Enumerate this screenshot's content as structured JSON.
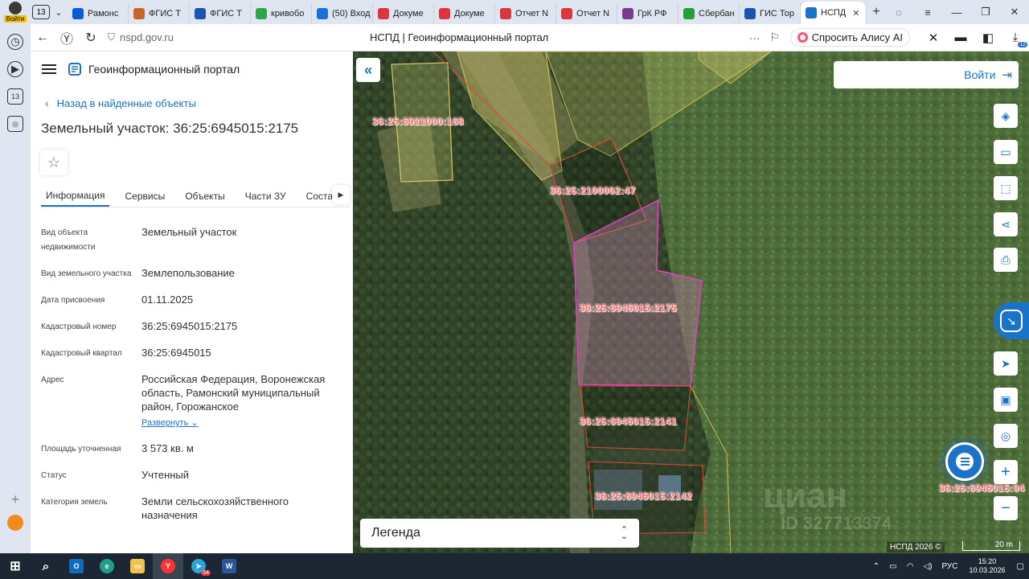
{
  "browser": {
    "profile_label": "Войти",
    "tab_count": "13",
    "tabs": [
      {
        "label": "Рамонс",
        "icon": "ozon-icon",
        "color": "#0a5bd8"
      },
      {
        "label": "ФГИС Т",
        "icon": "doc-icon",
        "color": "#c8652d"
      },
      {
        "label": "ФГИС Т",
        "icon": "emblem-icon",
        "color": "#1b55b0"
      },
      {
        "label": "кривобо",
        "icon": "flower-icon",
        "color": "#2aa84a"
      },
      {
        "label": "(50) Вход",
        "icon": "mail-icon",
        "color": "#1a6fd8"
      },
      {
        "label": "Докуме",
        "icon": "pdf-icon",
        "color": "#d9363e"
      },
      {
        "label": "Докуме",
        "icon": "pdf-icon",
        "color": "#d9363e"
      },
      {
        "label": "Отчет N",
        "icon": "pdf-icon",
        "color": "#d9363e"
      },
      {
        "label": "Отчет N",
        "icon": "pdf-icon",
        "color": "#d9363e"
      },
      {
        "label": "ГрК РФ",
        "icon": "consultant-icon",
        "color": "#7b3a8e"
      },
      {
        "label": "Сбербан",
        "icon": "sber-icon",
        "color": "#21a038"
      },
      {
        "label": "ГИС Тор",
        "icon": "emblem-icon",
        "color": "#1b55b0"
      },
      {
        "label": "НСПД",
        "icon": "nspd-icon",
        "color": "#1a73c9",
        "active": true
      }
    ],
    "url": "nspd.gov.ru",
    "page_title": "НСПД | Геоинформационный портал",
    "alice_label": "Спросить Алису AI",
    "downloads_badge": "12"
  },
  "panel": {
    "portal_title": "Геоинформационный портал",
    "back_link": "Назад в найденные объекты",
    "object_title": "Земельный участок: 36:25:6945015:2175",
    "tabs": [
      "Информация",
      "Сервисы",
      "Объекты",
      "Части ЗУ",
      "Состав"
    ],
    "attributes": [
      {
        "key": "Вид объекта недвижимости",
        "value": "Земельный участок"
      },
      {
        "key": "Вид земельного участка",
        "value": "Землепользование"
      },
      {
        "key": "Дата присвоения",
        "value": "01.11.2025"
      },
      {
        "key": "Кадастровый номер",
        "value": "36:25:6945015:2175"
      },
      {
        "key": "Кадастровый квартал",
        "value": "36:25:6945015"
      },
      {
        "key": "Адрес",
        "value": "Российская Федерация, Воронежская область, Рамонский муниципальный район, Горожанское"
      },
      {
        "key": "Площадь уточненная",
        "value": "3 573 кв. м"
      },
      {
        "key": "Статус",
        "value": "Учтенный"
      },
      {
        "key": "Категория земель",
        "value": "Земли сельскохозяйственного назначения"
      }
    ],
    "expand_label": "Развернуть"
  },
  "map": {
    "login_label": "Войти",
    "legend_label": "Легенда",
    "copyright": "НСПД 2026 ©",
    "scale_label": "20 m",
    "watermark": "циан",
    "watermark_id": "ID 327713374",
    "parcels": {
      "p1": "36:25:6921000:168",
      "p2": "36:25:2100002:47",
      "p3": "36:25:6945015:2175",
      "p4": "36:25:6945015:2141",
      "p5": "36:25:6945015:2142",
      "p6": "36:25:6945015:94"
    },
    "colors": {
      "selected": "#e040c0",
      "parcel_border": "#d94a3a",
      "accent": "#1a73c9"
    }
  },
  "taskbar": {
    "telegram_badge": "54",
    "tray_lang": "РУС",
    "time": "15:20",
    "date": "10.03.2026"
  }
}
